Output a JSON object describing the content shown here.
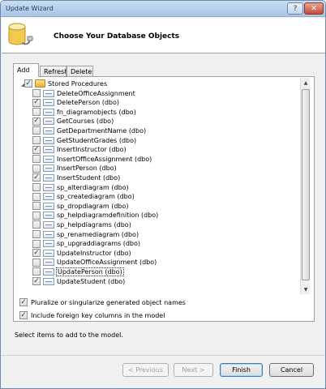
{
  "window": {
    "title": "Update Wizard",
    "help_glyph": "?",
    "close_glyph": "✕"
  },
  "header": {
    "heading": "Choose Your Database Objects"
  },
  "tabs": [
    {
      "label": "Add",
      "active": true
    },
    {
      "label": "Refresh",
      "active": false
    },
    {
      "label": "Delete",
      "active": false
    }
  ],
  "tree": {
    "root": {
      "label": "Stored Procedures",
      "checked": true,
      "expanded": true
    },
    "items": [
      {
        "label": "DeleteOfficeAssignment",
        "checked": false
      },
      {
        "label": "DeletePerson (dbo)",
        "checked": true
      },
      {
        "label": "fn_diagramobjects (dbo)",
        "checked": false
      },
      {
        "label": "GetCourses (dbo)",
        "checked": true
      },
      {
        "label": "GetDepartmentName (dbo)",
        "checked": false
      },
      {
        "label": "GetStudentGrades (dbo)",
        "checked": false
      },
      {
        "label": "InsertInstructor (dbo)",
        "checked": true
      },
      {
        "label": "InsertOfficeAssignment (dbo)",
        "checked": false
      },
      {
        "label": "InsertPerson (dbo)",
        "checked": false
      },
      {
        "label": "InsertStudent (dbo)",
        "checked": true
      },
      {
        "label": "sp_alterdiagram (dbo)",
        "checked": false
      },
      {
        "label": "sp_creatediagram (dbo)",
        "checked": false
      },
      {
        "label": "sp_dropdiagram (dbo)",
        "checked": false
      },
      {
        "label": "sp_helpdiagramdefinition (dbo)",
        "checked": false
      },
      {
        "label": "sp_helpdiagrams (dbo)",
        "checked": false
      },
      {
        "label": "sp_renamediagram (dbo)",
        "checked": false
      },
      {
        "label": "sp_upgraddiagrams (dbo)",
        "checked": false
      },
      {
        "label": "UpdateInstructor (dbo)",
        "checked": true
      },
      {
        "label": "UpdateOfficeAssignment (dbo)",
        "checked": false
      },
      {
        "label": "UpdatePerson (dbo)",
        "checked": false,
        "selected": true
      },
      {
        "label": "UpdateStudent (dbo)",
        "checked": true
      }
    ]
  },
  "options": {
    "pluralize": {
      "label": "Pluralize or singularize generated object names",
      "checked": true
    },
    "foreign_keys": {
      "label": "Include foreign key columns in the model",
      "checked": true
    }
  },
  "status": "Select items to add to the model.",
  "buttons": {
    "previous": "< Previous",
    "next": "Next >",
    "finish": "Finish",
    "cancel": "Cancel"
  }
}
